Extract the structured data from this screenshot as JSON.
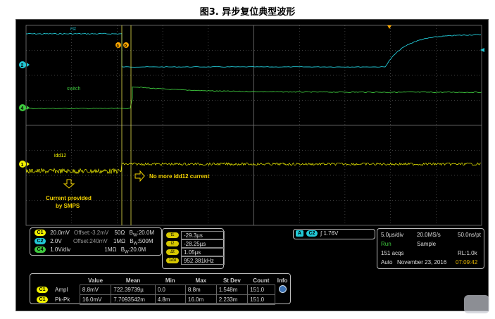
{
  "figure_title": "图3. 异步复位典型波形",
  "colors": {
    "ch1": "#f0f000",
    "ch2": "#22c9d6",
    "ch3": "#1ba8e0",
    "ch4": "#3ec83e",
    "grid": "#7a7a7a",
    "cursor": "#e7e14a",
    "annotation": "#f3d200",
    "orange_marker": "#f5a300"
  },
  "waveforms": {
    "labels": {
      "rst": "rst",
      "switch": "switch",
      "idd12": "idd12"
    },
    "channel_markers": {
      "ch2": "2",
      "ch4": "4",
      "ch1": "1"
    },
    "cursor_labels": {
      "a": "a",
      "b": "b"
    },
    "annotations": {
      "current_provided": "Current provided\nby SMPS",
      "current_provided_line1": "Current provided",
      "current_provided_line2": "by SMPS",
      "no_more": "No more idd12 current"
    }
  },
  "channels": [
    {
      "badge": "C1",
      "scale": "20.0mV",
      "offset": "Offset:-3.2mV",
      "impedance": "50Ω",
      "bw_prefix": "B",
      "bw_sub": "W",
      "bw": ":20.0M"
    },
    {
      "badge": "C2",
      "scale": "2.0V",
      "offset": "Offset:240mV",
      "impedance": "1MΩ",
      "bw_prefix": "B",
      "bw_sub": "W",
      "bw": ":500M"
    },
    {
      "badge": "C4",
      "scale": "1.0V/div",
      "offset": "",
      "impedance": "1MΩ",
      "bw_prefix": "B",
      "bw_sub": "W",
      "bw": ":20.0M"
    }
  ],
  "cursors": [
    {
      "badge": "t1",
      "value": "-29.3µs"
    },
    {
      "badge": "t2",
      "value": "-28.25µs"
    },
    {
      "badge": "Δt",
      "value": "1.05µs"
    },
    {
      "badge": "1/Δt",
      "value": "952.381kHz"
    }
  ],
  "trigger": {
    "badge_a": "A",
    "badge_ch": "C2",
    "slope": "∫",
    "level": "1.76V"
  },
  "acquisition": {
    "timebase": "5.0µs/div",
    "sample_rate": "20.0MS/s",
    "pt_rate": "50.0ns/pt",
    "run_state": "Run",
    "mode": "Sample",
    "acqs": "151 acqs",
    "record_length": "RL:1.0k",
    "trigger_mode": "Auto",
    "date": "November 23, 2016",
    "time": "07:09:42"
  },
  "measurements": {
    "headers": [
      "",
      "",
      "Value",
      "Mean",
      "Min",
      "Max",
      "St Dev",
      "Count",
      "Info"
    ],
    "rows": [
      {
        "badge": "C1",
        "name": "Ampl",
        "value": "8.8mV",
        "mean": "722.39739µ",
        "min": "0.0",
        "max": "8.8m",
        "stdev": "1.548m",
        "count": "151.0"
      },
      {
        "badge": "C1",
        "name": "Pk-Pk",
        "value": "16.0mV",
        "mean": "7.7093542m",
        "min": "4.8m",
        "max": "16.0m",
        "stdev": "2.233m",
        "count": "151.0"
      }
    ]
  }
}
